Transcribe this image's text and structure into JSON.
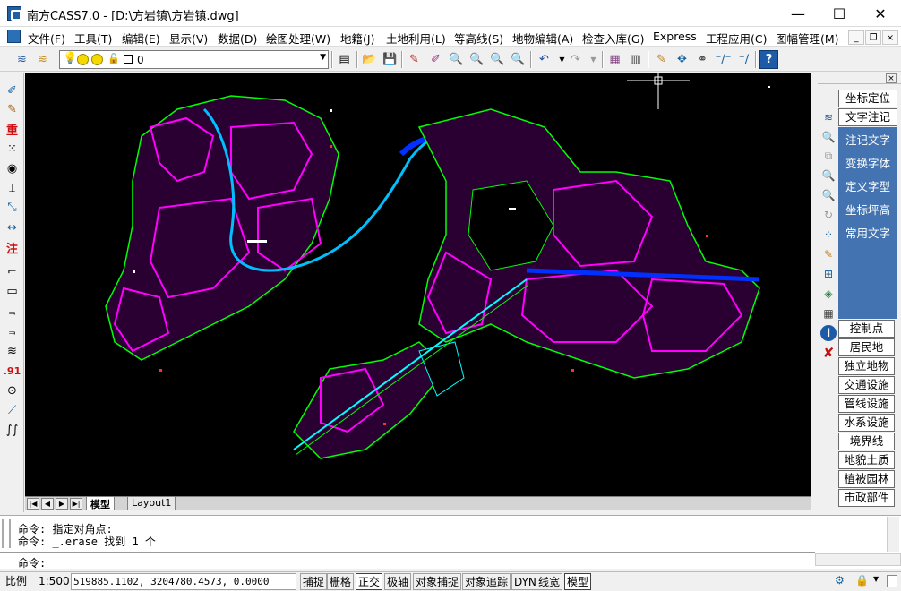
{
  "window": {
    "title": "南方CASS7.0 - [D:\\方岩镇\\方岩镇.dwg]",
    "minimize": "—",
    "maximize": "☐",
    "close": "✕"
  },
  "menus": [
    "文件(F)",
    "工具(T)",
    "编辑(E)",
    "显示(V)",
    "数据(D)",
    "绘图处理(W)",
    "地籍(J)",
    "土地利用(L)",
    "等高线(S)",
    "地物编辑(A)",
    "检查入库(G)",
    "Express",
    "工程应用(C)",
    "图幅管理(M)"
  ],
  "mdi": {
    "min": "_",
    "restore": "❐",
    "close": "×"
  },
  "toolbar": {
    "layer_value": "0"
  },
  "tabs": {
    "model": "模型",
    "layout1": "Layout1"
  },
  "right_panel": {
    "top_buttons": [
      "坐标定位",
      "文字注记"
    ],
    "items": [
      "注记文字",
      "变换字体",
      "定义字型",
      "坐标坪高",
      "常用文字"
    ],
    "categories": [
      "控制点",
      "居民地",
      "独立地物",
      "交通设施",
      "管线设施",
      "水系设施",
      "境界线",
      "地貌土质",
      "植被园林",
      "市政部件"
    ]
  },
  "command": {
    "line1": "命令: 指定对角点:",
    "line2": "命令: _.erase 找到 1 个",
    "prompt": "命令:"
  },
  "status": {
    "scale_label": "比例",
    "scale_value": "1:500",
    "coords": "519885.1102, 3204780.4573, 0.0000",
    "toggles": [
      "捕捉",
      "栅格",
      "正交",
      "极轴",
      "对象捕捉",
      "对象追踪",
      "DYN",
      "线宽",
      "模型"
    ]
  },
  "colors": {
    "canvas": "#000000",
    "accent": "#4373b0",
    "parcels": "#ff00ff",
    "roads": "#00ff00"
  }
}
